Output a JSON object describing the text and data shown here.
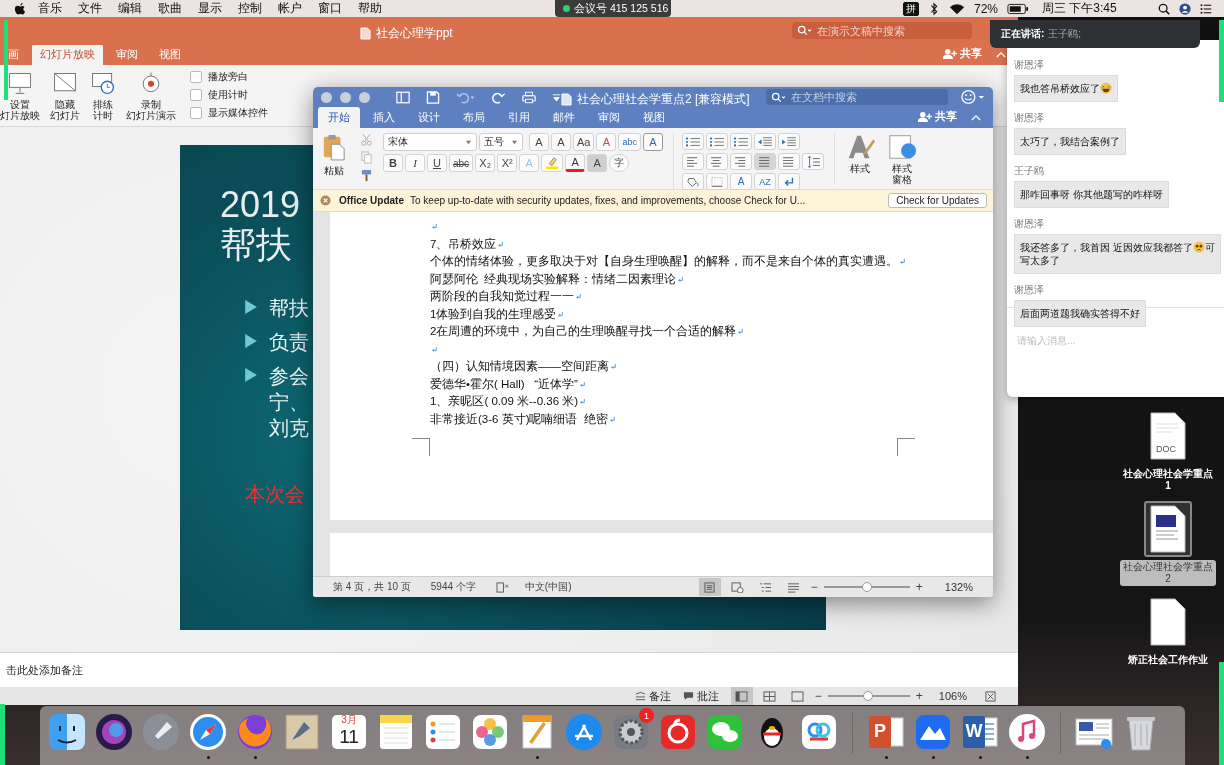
{
  "menu_bar": {
    "menus": [
      "音乐",
      "文件",
      "编辑",
      "歌曲",
      "显示",
      "控制",
      "帐户",
      "窗口",
      "帮助"
    ],
    "meeting": "会议号 415 125 516",
    "input_method": "拼",
    "battery": "72%",
    "clock": "周三 下午3:45"
  },
  "powerpoint": {
    "title": "社会心理学ppt",
    "search": {
      "placeholder": "在演示文稿中搜索"
    },
    "tabs": [
      {
        "label": "画",
        "selected": false
      },
      {
        "label": "幻灯片放映",
        "selected": true
      },
      {
        "label": "审阅",
        "selected": false
      },
      {
        "label": "视图",
        "selected": false
      }
    ],
    "share": "共享",
    "ribbon": [
      {
        "kind": "setup",
        "lines": [
          "设置",
          "灯片放映"
        ]
      },
      {
        "kind": "hide",
        "lines": [
          "隐藏",
          "幻灯片"
        ]
      },
      {
        "kind": "rehearse",
        "lines": [
          "排练",
          "计时"
        ]
      },
      {
        "kind": "record",
        "lines": [
          "录制",
          "幻灯片演示"
        ]
      }
    ],
    "options": [
      {
        "label": "播放旁白",
        "checked": false
      },
      {
        "label": "使用计时",
        "checked": false
      },
      {
        "label": "显示媒体控件",
        "checked": false
      }
    ],
    "slide": {
      "title_lines": [
        "2019",
        "帮扶"
      ],
      "bullets": [
        {
          "lines": [
            "帮扶"
          ]
        },
        {
          "lines": [
            "负责"
          ]
        },
        {
          "lines": [
            "参会",
            "宁、",
            "刘克"
          ]
        }
      ],
      "note": "本次会"
    },
    "notes": {
      "placeholder": "击此处添加备注"
    },
    "status": {
      "notes": "备注",
      "comments": "批注",
      "views": [
        {
          "kind": "normal",
          "selected": true
        },
        {
          "kind": "sorter",
          "selected": false
        },
        {
          "kind": "presenter",
          "selected": false
        }
      ],
      "zoom": {
        "out": "−",
        "level": 0.49,
        "in": "+",
        "reading": "106%"
      }
    }
  },
  "word": {
    "title": "社会心理社会学重点2 [兼容模式]",
    "search": {
      "placeholder": "在文档中搜索"
    },
    "tabs": [
      {
        "label": "开始",
        "selected": true
      },
      {
        "label": "插入",
        "selected": false
      },
      {
        "label": "设计",
        "selected": false
      },
      {
        "label": "布局",
        "selected": false
      },
      {
        "label": "引用",
        "selected": false
      },
      {
        "label": "邮件",
        "selected": false
      },
      {
        "label": "审阅",
        "selected": false
      },
      {
        "label": "视图",
        "selected": false
      }
    ],
    "share": "共享",
    "paste": "粘贴",
    "font": {
      "value": "宋体"
    },
    "size": {
      "value": "五号"
    },
    "font_tools": [
      {
        "kind": "grow",
        "glyph": "A"
      },
      {
        "kind": "shrink",
        "glyph": "A"
      },
      {
        "kind": "case",
        "glyph": "Aa"
      },
      {
        "kind": "clear",
        "glyph": "A"
      },
      {
        "kind": "phonetic",
        "glyph": "abc"
      },
      {
        "kind": "border",
        "glyph": "A"
      }
    ],
    "format_tools": [
      {
        "kind": "bold",
        "glyph": "B"
      },
      {
        "kind": "italic",
        "glyph": "I"
      },
      {
        "kind": "underline",
        "glyph": "U"
      },
      {
        "kind": "strike",
        "glyph": "abc"
      },
      {
        "kind": "sub",
        "glyph": "X₂"
      },
      {
        "kind": "sup",
        "glyph": "X²"
      },
      {
        "kind": "effects",
        "glyph": "A"
      },
      {
        "kind": "highlight"
      },
      {
        "kind": "color",
        "glyph": "A"
      },
      {
        "kind": "shading",
        "glyph": "A"
      },
      {
        "kind": "enclose",
        "glyph": "字"
      }
    ],
    "list_tools": [
      {
        "kind": "bullets"
      },
      {
        "kind": "numbering"
      },
      {
        "kind": "multilevel"
      },
      {
        "kind": "outdent"
      },
      {
        "kind": "indent"
      }
    ],
    "alignment": [
      {
        "kind": "left",
        "selected": false
      },
      {
        "kind": "center",
        "selected": false
      },
      {
        "kind": "right",
        "selected": false
      },
      {
        "kind": "justify",
        "selected": true
      },
      {
        "kind": "distributed",
        "selected": false
      },
      {
        "kind": "spacing",
        "selected": false
      }
    ],
    "more_tools": [
      {
        "kind": "shading"
      },
      {
        "kind": "borders"
      },
      {
        "kind": "asian",
        "glyph": "A"
      },
      {
        "kind": "sort",
        "glyph": "AZ"
      },
      {
        "kind": "marks"
      }
    ],
    "styles": {
      "label": "样式",
      "pane_lines": [
        "样式",
        "窗格"
      ]
    },
    "update_bar": {
      "title": "Office Update",
      "message": "To keep up-to-date with security updates, fixes, and improvements, choose Check for U...",
      "button": "Check for Updates"
    },
    "paragraphs": [
      {
        "kind": "empty"
      },
      {
        "kind": "text",
        "text": "7、吊桥效应"
      },
      {
        "kind": "text",
        "text": "个体的情绪体验，更多取决于对【自身生理唤醒】的解释，而不是来自个体的真实遭遇。"
      },
      {
        "kind": "text",
        "text": "阿瑟阿伦  经典现场实验解释：情绪二因素理论"
      },
      {
        "kind": "text",
        "text": "两阶段的自我知觉过程一一"
      },
      {
        "kind": "text",
        "text": "1体验到自我的生理感受"
      },
      {
        "kind": "text",
        "text": "2在周遭的环境中，为自己的生理唤醒寻找一个合适的解释"
      },
      {
        "kind": "empty"
      },
      {
        "kind": "text",
        "text": "（四）认知情境因素——空间距离"
      },
      {
        "kind": "text",
        "text": "爱德华•霍尔( Hall)   “近体学”"
      },
      {
        "kind": "text",
        "text": "1、亲昵区( 0.09 米--0.36 米)"
      },
      {
        "kind": "text",
        "text": "非常接近(3-6 英寸)呢喃细语  绝密"
      }
    ],
    "status": {
      "page": "第 4 页，共 10 页",
      "words": "5944 个字",
      "language": "中文(中国)",
      "views": [
        {
          "kind": "print",
          "selected": true
        },
        {
          "kind": "web",
          "selected": false
        },
        {
          "kind": "outline",
          "selected": false
        },
        {
          "kind": "draft",
          "selected": false
        }
      ],
      "zoom": {
        "out": "−",
        "level": 0.5,
        "in": "+",
        "reading": "132%"
      }
    }
  },
  "chat": {
    "speaking": {
      "label": "正在讲话:",
      "name": "王子鸥;"
    },
    "messages": [
      {
        "kind": "laughing",
        "sender": "谢恩泽",
        "text": "我也答吊桥效应了"
      },
      {
        "kind": "plain",
        "sender": "谢恩泽",
        "text": "太巧了，我结合案例了"
      },
      {
        "kind": "plain",
        "sender": "王子鸥",
        "text": "那咋回事呀 你其他题写的咋样呀"
      },
      {
        "kind": "pleading",
        "sender": "谢恩泽",
        "text": "我还答多了，我首因 近因效应我都答了",
        "text_after": "可",
        "next_line": "写太多了"
      },
      {
        "kind": "plain",
        "sender": "谢恩泽",
        "text": "后面两道题我确实答得不好"
      }
    ],
    "input": {
      "placeholder": "请输入消息..."
    }
  },
  "desktop_files": [
    {
      "kind": "doc",
      "badge": "DOC",
      "lines": [
        "社会心理社会学重点",
        "1"
      ],
      "selected": false
    },
    {
      "kind": "thumbnail",
      "lines": [
        "社会心理社会学重点",
        "2"
      ],
      "selected": true
    },
    {
      "kind": "blank",
      "lines": [
        "矫正社会工作作业"
      ],
      "selected": false
    }
  ],
  "dock": {
    "apps": [
      {
        "kind": "finder",
        "running": false
      },
      {
        "kind": "siri",
        "running": false
      },
      {
        "kind": "launchpad",
        "running": false
      },
      {
        "kind": "safari",
        "running": true
      },
      {
        "kind": "firefox",
        "running": true
      },
      {
        "kind": "mail",
        "running": false
      },
      {
        "kind": "calendar",
        "month": "3月",
        "day": "11",
        "running": false
      },
      {
        "kind": "notes",
        "running": false
      },
      {
        "kind": "reminders",
        "running": false
      },
      {
        "kind": "photos",
        "running": false
      },
      {
        "kind": "pages",
        "running": true
      },
      {
        "kind": "appstore",
        "running": false
      },
      {
        "kind": "settings",
        "badge": "1",
        "running": false
      },
      {
        "kind": "netease",
        "running": false
      },
      {
        "kind": "wechat",
        "running": false
      },
      {
        "kind": "qq",
        "running": false
      },
      {
        "kind": "baidu",
        "running": false
      }
    ],
    "documents": [
      {
        "kind": "powerpoint",
        "glyph": "P",
        "running": true
      },
      {
        "kind": "lark",
        "running": true
      },
      {
        "kind": "word",
        "glyph": "W",
        "running": true
      },
      {
        "kind": "itunes",
        "running": true
      }
    ],
    "utilities": [
      {
        "kind": "preview",
        "running": false
      },
      {
        "kind": "trash",
        "running": false
      }
    ]
  }
}
